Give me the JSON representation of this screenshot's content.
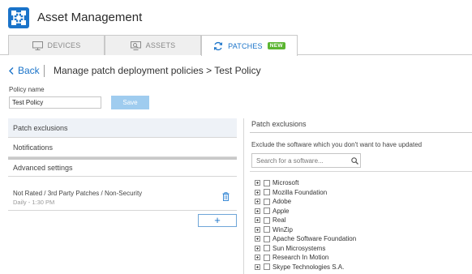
{
  "app": {
    "title": "Asset Management",
    "logo_icon": "network-grid-icon",
    "brand_color": "#1a73c9"
  },
  "tabs": [
    {
      "label": "DEVICES",
      "icon": "monitor-icon",
      "active": false
    },
    {
      "label": "ASSETS",
      "icon": "asset-scan-icon",
      "active": false
    },
    {
      "label": "PATCHES",
      "icon": "refresh-icon",
      "active": true,
      "badge": "NEW"
    }
  ],
  "breadcrumb": {
    "back_label": "Back",
    "path": "Manage patch deployment policies > Test Policy"
  },
  "policy": {
    "name_label": "Policy name",
    "name_value": "Test Policy",
    "save_label": "Save"
  },
  "left_nav": {
    "items": [
      {
        "label": "Patch exclusions",
        "selected": true
      },
      {
        "label": "Notifications",
        "selected": false
      },
      {
        "label": "Advanced settings",
        "selected": false
      }
    ],
    "rule": {
      "title": "Not Rated / 3rd Party Patches / Non-Security",
      "schedule": "Daily - 1:30 PM"
    },
    "add_label": "+"
  },
  "exclusions": {
    "title": "Patch exclusions",
    "description": "Exclude the software which you don't want to have updated",
    "search_placeholder": "Search for a software...",
    "vendors": [
      "Microsoft",
      "Mozilla Foundation",
      "Adobe",
      "Apple",
      "Real",
      "WinZip",
      "Apache Software Foundation",
      "Sun Microsystems",
      "Research In Motion",
      "Skype Technologies S.A."
    ]
  }
}
